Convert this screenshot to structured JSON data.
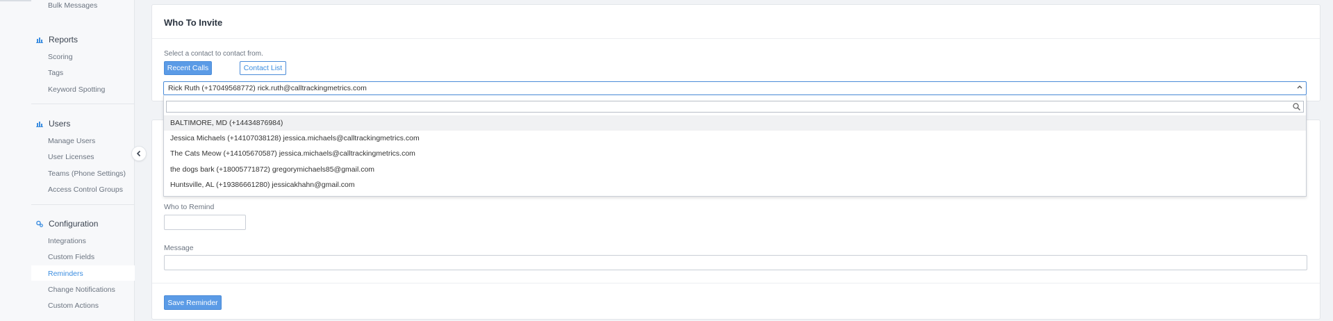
{
  "sidebar": {
    "bulk_messages": "Bulk Messages",
    "reports": {
      "label": "Reports",
      "icon": "bar-chart-icon",
      "items": [
        "Scoring",
        "Tags",
        "Keyword Spotting"
      ]
    },
    "users": {
      "label": "Users",
      "icon": "bar-chart-icon",
      "items": [
        "Manage Users",
        "User Licenses",
        "Teams (Phone Settings)",
        "Access Control Groups"
      ]
    },
    "configuration": {
      "label": "Configuration",
      "icon": "gears-icon",
      "items": [
        "Integrations",
        "Custom Fields",
        "Reminders",
        "Change Notifications",
        "Custom Actions"
      ],
      "active": "Reminders"
    },
    "collapse_icon": "chevron-left-icon"
  },
  "who_to_invite": {
    "title": "Who To Invite",
    "hint": "Select a contact to contact from.",
    "recent_calls_label": "Recent Calls",
    "contact_list_label": "Contact List",
    "selected_value": "Rick Ruth (+17049568772) rick.ruth@calltrackingmetrics.com",
    "dropdown": {
      "search_value": "",
      "options": [
        "BALTIMORE, MD (+14434876984)",
        "Jessica Michaels (+14107038128) jessica.michaels@calltrackingmetrics.com",
        "The Cats Meow (+14105670587) jessica.michaels@calltrackingmetrics.com",
        "the dogs bark (+18005771872) gregorymichaels85@gmail.com",
        "Huntsville, AL (+19386661280) jessicakhahn@gmail.com"
      ],
      "highlighted_index": 0
    }
  },
  "reminder_form": {
    "who_to_remind_label": "Who to Remind",
    "who_to_remind_value": "",
    "message_label": "Message",
    "message_value": "",
    "save_label": "Save Reminder"
  },
  "colors": {
    "accent": "#3b8de0",
    "primary_button": "#5b9be6",
    "background": "#f1f3f6"
  }
}
